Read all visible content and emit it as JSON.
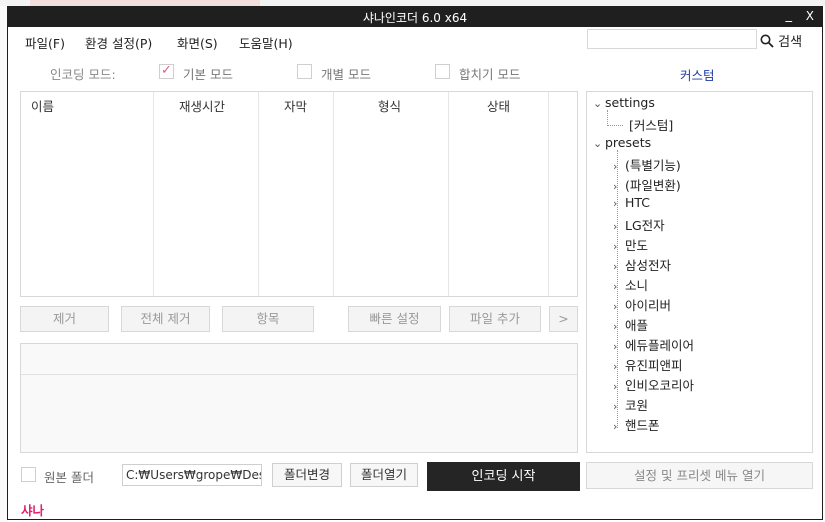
{
  "window": {
    "title": "샤나인코더  6.0  x64",
    "minimize": "_",
    "close": "X"
  },
  "menu": [
    "파일(F)",
    "환경 설정(P)",
    "화면(S)",
    "도움말(H)"
  ],
  "search": {
    "placeholder": "",
    "button_label": "검색"
  },
  "encoding_mode": {
    "label": "인코딩 모드:",
    "options": [
      {
        "label": "기본 모드",
        "checked": true
      },
      {
        "label": "개별 모드",
        "checked": false
      },
      {
        "label": "합치기 모드",
        "checked": false
      }
    ],
    "custom_link": "커스텀"
  },
  "file_table": {
    "columns": [
      "이름",
      "재생시간",
      "자막",
      "형식",
      "상태"
    ],
    "rows": []
  },
  "list_buttons": {
    "remove": "제거",
    "remove_all": "전체 제거",
    "item": "항목",
    "quick_settings": "빠른 설정",
    "add_file": "파일 추가",
    "more": ">"
  },
  "preset_tree": {
    "settings": {
      "label": "settings",
      "children": [
        "[커스텀]"
      ]
    },
    "presets": {
      "label": "presets",
      "children": [
        "(특별기능)",
        "(파일변환)",
        "HTC",
        "LG전자",
        "만도",
        "삼성전자",
        "소니",
        "아이리버",
        "애플",
        "에듀플레이어",
        "유진피앤피",
        "인비오코리아",
        "코원",
        "핸드폰"
      ]
    }
  },
  "bottom": {
    "source_folder_label": "원본 폴더",
    "source_folder_checked": false,
    "path": "C:₩Users₩grope₩Des",
    "change_folder": "폴더변경",
    "open_folder": "폴더열기",
    "start_encoding": "인코딩 시작",
    "open_settings": "설정 및 프리셋 메뉴 열기"
  },
  "status_text": "샤나",
  "colors": {
    "titlebar": "#1f1f1f",
    "accent_link": "#1d3aa8",
    "status": "#e0206c",
    "check": "#e06080",
    "primary_button": "#252525"
  }
}
